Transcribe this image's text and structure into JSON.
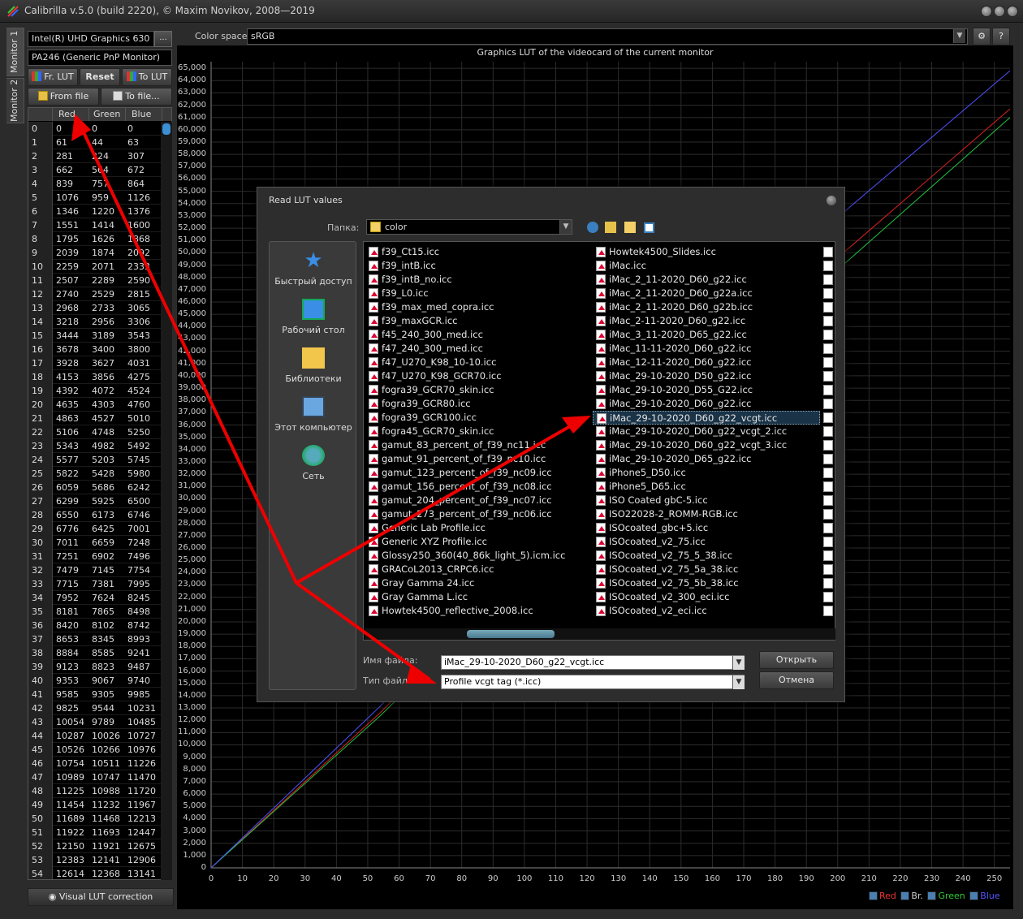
{
  "window": {
    "title": "Calibrilla v.5.0 (build 2220), © Maxim Novikov, 2008—2019"
  },
  "tabs": [
    "Monitor 1",
    "Monitor 2"
  ],
  "left": {
    "gpu": "Intel(R) UHD Graphics 630",
    "dots": "...",
    "monitor": "PA246 (Generic PnP Monitor)",
    "btn_fr_lut": "Fr. LUT",
    "btn_reset": "Reset",
    "btn_to_lut": "To LUT",
    "btn_from_file": "From file",
    "btn_to_file": "To file...",
    "headers": [
      "Red",
      "Green",
      "Blue"
    ],
    "rows": [
      [
        "0",
        "0",
        "0",
        "0"
      ],
      [
        "1",
        "61",
        "44",
        "63"
      ],
      [
        "2",
        "281",
        "224",
        "307"
      ],
      [
        "3",
        "662",
        "564",
        "672"
      ],
      [
        "4",
        "839",
        "757",
        "864"
      ],
      [
        "5",
        "1076",
        "959",
        "1126"
      ],
      [
        "6",
        "1346",
        "1220",
        "1376"
      ],
      [
        "7",
        "1551",
        "1414",
        "1600"
      ],
      [
        "8",
        "1795",
        "1626",
        "1868"
      ],
      [
        "9",
        "2039",
        "1874",
        "2092"
      ],
      [
        "10",
        "2259",
        "2071",
        "2333"
      ],
      [
        "11",
        "2507",
        "2289",
        "2590"
      ],
      [
        "12",
        "2740",
        "2529",
        "2815"
      ],
      [
        "13",
        "2968",
        "2733",
        "3065"
      ],
      [
        "14",
        "3218",
        "2956",
        "3306"
      ],
      [
        "15",
        "3444",
        "3189",
        "3543"
      ],
      [
        "16",
        "3678",
        "3400",
        "3800"
      ],
      [
        "17",
        "3928",
        "3627",
        "4031"
      ],
      [
        "18",
        "4153",
        "3856",
        "4275"
      ],
      [
        "19",
        "4392",
        "4072",
        "4524"
      ],
      [
        "20",
        "4635",
        "4303",
        "4760"
      ],
      [
        "21",
        "4863",
        "4527",
        "5010"
      ],
      [
        "22",
        "5106",
        "4748",
        "5250"
      ],
      [
        "23",
        "5343",
        "4982",
        "5492"
      ],
      [
        "24",
        "5577",
        "5203",
        "5745"
      ],
      [
        "25",
        "5822",
        "5428",
        "5980"
      ],
      [
        "26",
        "6059",
        "5686",
        "6242"
      ],
      [
        "27",
        "6299",
        "5925",
        "6500"
      ],
      [
        "28",
        "6550",
        "6173",
        "6746"
      ],
      [
        "29",
        "6776",
        "6425",
        "7001"
      ],
      [
        "30",
        "7011",
        "6659",
        "7248"
      ],
      [
        "31",
        "7251",
        "6902",
        "7496"
      ],
      [
        "32",
        "7479",
        "7145",
        "7754"
      ],
      [
        "33",
        "7715",
        "7381",
        "7995"
      ],
      [
        "34",
        "7952",
        "7624",
        "8245"
      ],
      [
        "35",
        "8181",
        "7865",
        "8498"
      ],
      [
        "36",
        "8420",
        "8102",
        "8742"
      ],
      [
        "37",
        "8653",
        "8345",
        "8993"
      ],
      [
        "38",
        "8884",
        "8585",
        "9241"
      ],
      [
        "39",
        "9123",
        "8823",
        "9487"
      ],
      [
        "40",
        "9353",
        "9067",
        "9740"
      ],
      [
        "41",
        "9585",
        "9305",
        "9985"
      ],
      [
        "42",
        "9825",
        "9544",
        "10231"
      ],
      [
        "43",
        "10054",
        "9789",
        "10485"
      ],
      [
        "44",
        "10287",
        "10026",
        "10727"
      ],
      [
        "45",
        "10526",
        "10266",
        "10976"
      ],
      [
        "46",
        "10754",
        "10511",
        "11226"
      ],
      [
        "47",
        "10989",
        "10747",
        "11470"
      ],
      [
        "48",
        "11225",
        "10988",
        "11720"
      ],
      [
        "49",
        "11454",
        "11232",
        "11967"
      ],
      [
        "50",
        "11689",
        "11468",
        "12213"
      ],
      [
        "51",
        "11922",
        "11693",
        "12447"
      ],
      [
        "52",
        "12150",
        "11921",
        "12675"
      ],
      [
        "53",
        "12383",
        "12141",
        "12906"
      ],
      [
        "54",
        "12614",
        "12368",
        "13141"
      ]
    ],
    "visual_btn": "Visual LUT correction"
  },
  "top": {
    "colorspace_label": "Color space:",
    "colorspace": "sRGB"
  },
  "chart_data": {
    "type": "line",
    "title": "Graphics LUT of the videocard of the current monitor",
    "xlim": [
      0,
      255
    ],
    "ylim": [
      0,
      65535
    ],
    "x_ticks": [
      "0",
      "10",
      "20",
      "30",
      "40",
      "50",
      "60",
      "70",
      "80",
      "90",
      "100",
      "110",
      "120",
      "130",
      "140",
      "150",
      "160",
      "170",
      "180",
      "190",
      "200",
      "210",
      "220",
      "230",
      "240",
      "250"
    ],
    "y_ticks": [
      "0",
      "1,000",
      "2,000",
      "3,000",
      "4,000",
      "5,000",
      "6,000",
      "7,000",
      "8,000",
      "9,000",
      "10,000",
      "11,000",
      "12,000",
      "13,000",
      "14,000",
      "15,000",
      "16,000",
      "17,000",
      "18,000",
      "19,000",
      "20,000",
      "21,000",
      "22,000",
      "23,000",
      "24,000",
      "25,000",
      "26,000",
      "27,000",
      "28,000",
      "29,000",
      "30,000",
      "31,000",
      "32,000",
      "33,000",
      "34,000",
      "35,000",
      "36,000",
      "37,000",
      "38,000",
      "39,000",
      "40,000",
      "41,000",
      "42,000",
      "43,000",
      "44,000",
      "45,000",
      "46,000",
      "47,000",
      "48,000",
      "49,000",
      "50,000",
      "51,000",
      "52,000",
      "53,000",
      "54,000",
      "55,000",
      "56,000",
      "57,000",
      "58,000",
      "59,000",
      "60,000",
      "61,000",
      "62,000",
      "63,000",
      "64,000",
      "65,000"
    ],
    "series": [
      {
        "name": "Red",
        "color": "#e02020",
        "x": [
          0,
          54,
          195,
          255
        ],
        "y": [
          0,
          12614,
          48500,
          61700
        ]
      },
      {
        "name": "Green",
        "color": "#20c040",
        "x": [
          0,
          54,
          195,
          255
        ],
        "y": [
          0,
          12368,
          47500,
          61000
        ]
      },
      {
        "name": "Blue",
        "color": "#5050ff",
        "x": [
          0,
          54,
          195,
          255
        ],
        "y": [
          0,
          13141,
          51800,
          64800
        ]
      }
    ],
    "legend": {
      "red": "Red",
      "br": "Br.",
      "green": "Green",
      "blue": "Blue",
      "position": "bottom-right"
    },
    "grid": true
  },
  "dialog": {
    "title": "Read LUT values",
    "folder_label": "Папка:",
    "folder": "color",
    "places": [
      "Быстрый доступ",
      "Рабочий стол",
      "Библиотеки",
      "Этот компьютер",
      "Сеть"
    ],
    "files_col1": [
      "f39_Ct15.icc",
      "f39_intB.icc",
      "f39_intB_no.icc",
      "f39_L0.icc",
      "f39_max_med_copra.icc",
      "f39_maxGCR.icc",
      "f45_240_300_med.icc",
      "f47_240_300_med.icc",
      "f47_U270_K98_10-10.icc",
      "f47_U270_K98_GCR70.icc",
      "fogra39_GCR70_skin.icc",
      "fogra39_GCR80.icc",
      "fogra39_GCR100.icc",
      "fogra45_GCR70_skin.icc",
      "gamut_83_percent_of_f39_nc11.icc",
      "gamut_91_percent_of_f39_nc10.icc",
      "gamut_123_percent_of_f39_nc09.icc",
      "gamut_156_percent_of_f39_nc08.icc",
      "gamut_204_percent_of_f39_nc07.icc",
      "gamut_273_percent_of_f39_nc06.icc",
      "Generic Lab Profile.icc",
      "Generic XYZ Profile.icc",
      "Glossy250_360(40_86k_light_5).icm.icc",
      "GRACoL2013_CRPC6.icc",
      "Gray Gamma 24.icc",
      "Gray Gamma L.icc",
      "Howtek4500_reflective_2008.icc"
    ],
    "files_col2": [
      "Howtek4500_Slides.icc",
      "iMac.icc",
      "iMac_2_11-2020_D60_g22.icc",
      "iMac_2_11-2020_D60_g22a.icc",
      "iMac_2_11-2020_D60_g22b.icc",
      "iMac_2-11-2020_D60_g22.icc",
      "iMac_3_11-2020_D65_g22.icc",
      "iMac_11-11-2020_D60_g22.icc",
      "iMac_12-11-2020_D60_g22.icc",
      "iMac_29-10-2020_D50_g22.icc",
      "iMac_29-10-2020_D55_G22.icc",
      "iMac_29-10-2020_D60_g22.icc",
      "iMac_29-10-2020_D60_g22_vcgt.icc",
      "iMac_29-10-2020_D60_g22_vcgt_2.icc",
      "iMac_29-10-2020_D60_g22_vcgt_3.icc",
      "iMac_29-10-2020_D65_g22.icc",
      "iPhone5_D50.icc",
      "iPhone5_D65.icc",
      "ISO Coated gbC-5.icc",
      "ISO22028-2_ROMM-RGB.icc",
      "ISOcoated_gbc+5.icc",
      "ISOcoated_v2_75.icc",
      "ISOcoated_v2_75_5_38.icc",
      "ISOcoated_v2_75_5a_38.icc",
      "ISOcoated_v2_75_5b_38.icc",
      "ISOcoated_v2_300_eci.icc",
      "ISOcoated_v2_eci.icc"
    ],
    "selected_index": 12,
    "filename_label": "Имя файла:",
    "filename": "iMac_29-10-2020_D60_g22_vcgt.icc",
    "filetype_label": "Тип файлов:",
    "filetype": "Profile vcgt tag (*.icc)",
    "open": "Открыть",
    "cancel": "Отмена"
  }
}
